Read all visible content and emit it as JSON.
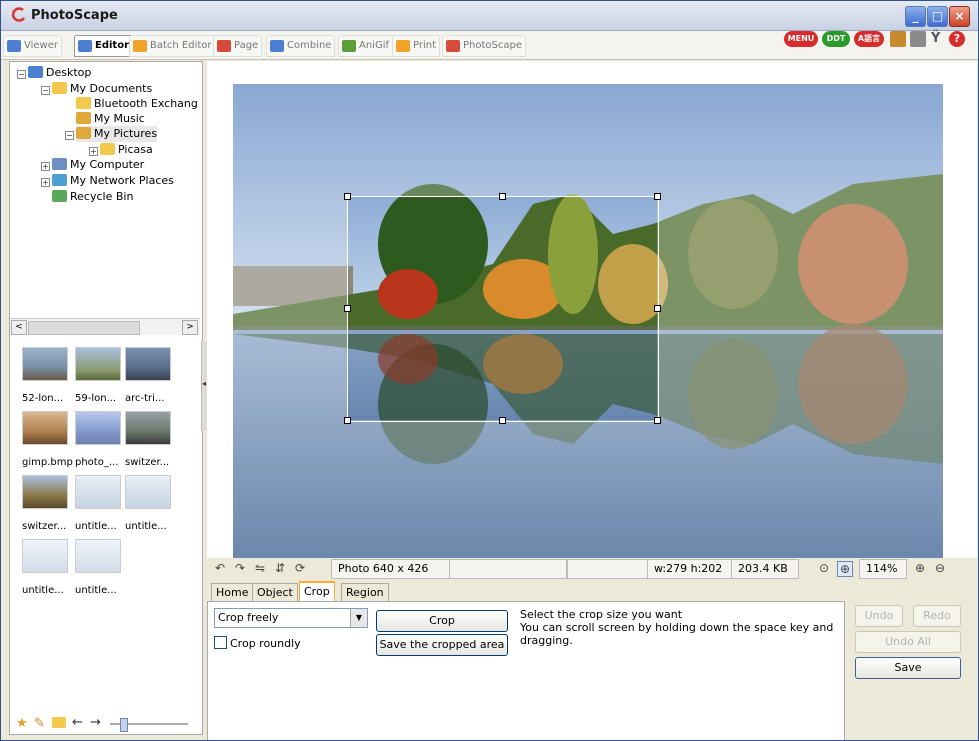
{
  "window": {
    "title": "PhotoScape"
  },
  "tabs": [
    {
      "label": "Viewer",
      "color": "#4c7fd1"
    },
    {
      "label": "Editor",
      "color": "#f0a22a",
      "active": true
    },
    {
      "label": "Batch Editor",
      "color": "#f0a22a"
    },
    {
      "label": "Page",
      "color": "#d64b3a"
    },
    {
      "label": "Combine",
      "color": "#4c7fd1"
    },
    {
      "label": "AniGif",
      "color": "#5b9e3a"
    },
    {
      "label": "Print",
      "color": "#f0a22a"
    },
    {
      "label": "PhotoScape",
      "color": "#d64b3a"
    }
  ],
  "top_icons": [
    "MENU",
    "DDT",
    "A語言"
  ],
  "tree": [
    {
      "label": "Desktop",
      "icon": "desktop-icon",
      "expander": "minus"
    },
    {
      "label": "My Documents",
      "icon": "folder-icon",
      "expander": "minus"
    },
    {
      "label": "Bluetooth Exchang",
      "icon": "folder-icon"
    },
    {
      "label": "My Music",
      "icon": "music-folder-icon"
    },
    {
      "label": "My Pictures",
      "icon": "pictures-folder-icon",
      "expander": "minus",
      "selected": true
    },
    {
      "label": "Picasa",
      "icon": "folder-icon",
      "expander": "plus"
    },
    {
      "label": "My Computer",
      "icon": "computer-icon",
      "expander": "plus"
    },
    {
      "label": "My Network Places",
      "icon": "network-icon",
      "expander": "plus"
    },
    {
      "label": "Recycle Bin",
      "icon": "recycle-bin-icon"
    }
  ],
  "thumbnails": [
    {
      "label": "52-lon...",
      "color": "#7a8fa6"
    },
    {
      "label": "59-lon...",
      "color": "#8a9a6e"
    },
    {
      "label": "arc-tri...",
      "color": "#5a6f8c"
    },
    {
      "label": "gimp.bmp",
      "color": "#b08050"
    },
    {
      "label": "photo_...",
      "color": "#8aa0d0"
    },
    {
      "label": "switzer...",
      "color": "#6a7a6a"
    },
    {
      "label": "switzer...",
      "color": "#8c7a4a"
    },
    {
      "label": "untitle...",
      "color": "#c7d3e3"
    },
    {
      "label": "untitle...",
      "color": "#c7d3e3"
    },
    {
      "label": "untitle...",
      "color": "#d3dde8"
    },
    {
      "label": "untitle...",
      "color": "#d3dde8"
    }
  ],
  "status": {
    "photo_info": "Photo 640 x 426",
    "selection": "w:279 h:202",
    "file_size": "203.4 KB",
    "zoom": "114%"
  },
  "edit_tabs": [
    {
      "label": "Home"
    },
    {
      "label": "Object"
    },
    {
      "label": "Crop",
      "active": true
    },
    {
      "label": "Region"
    }
  ],
  "crop": {
    "mode": "Crop freely",
    "round_label": "Crop roundly",
    "crop_button": "Crop",
    "save_area_button": "Save the cropped area",
    "help_text": "Select the crop size you want\nYou can scroll screen by holding down the space key and dragging."
  },
  "actions": {
    "undo": "Undo",
    "redo": "Redo",
    "undo_all": "Undo All",
    "save": "Save"
  }
}
